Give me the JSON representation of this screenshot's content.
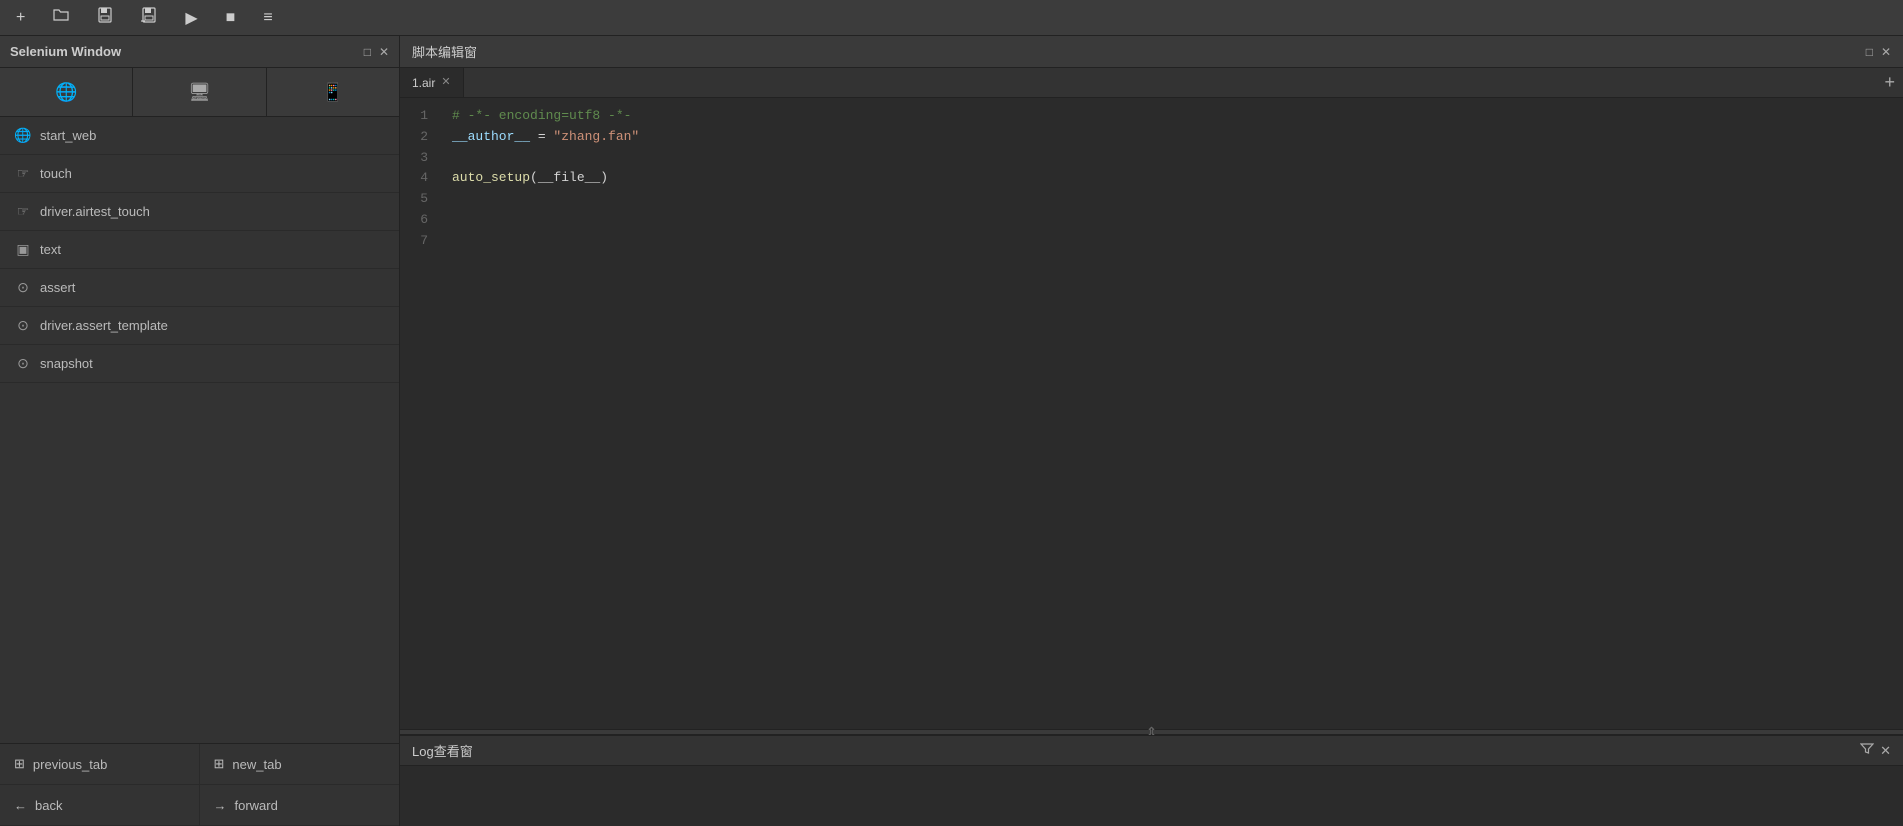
{
  "toolbar": {
    "buttons": [
      {
        "name": "new-file",
        "icon": "+",
        "label": "New"
      },
      {
        "name": "open-file",
        "icon": "📁",
        "label": "Open"
      },
      {
        "name": "save-file",
        "icon": "💾",
        "label": "Save"
      },
      {
        "name": "save-all",
        "icon": "💾",
        "label": "SaveAll"
      },
      {
        "name": "run",
        "icon": "▶",
        "label": "Run"
      },
      {
        "name": "stop",
        "icon": "■",
        "label": "Stop"
      },
      {
        "name": "menu",
        "icon": "≡",
        "label": "Menu"
      }
    ]
  },
  "sidebar": {
    "title": "Selenium Window",
    "icon_tabs": [
      {
        "name": "globe-icon",
        "icon": "🌐"
      },
      {
        "name": "monitor-icon",
        "icon": "🖥"
      },
      {
        "name": "device-icon",
        "icon": "📱"
      }
    ],
    "items": [
      {
        "name": "start-web",
        "icon": "🌐",
        "label": "start_web"
      },
      {
        "name": "touch",
        "icon": "☞",
        "label": "touch"
      },
      {
        "name": "driver-airtest-touch",
        "icon": "☞",
        "label": "driver.airtest_touch"
      },
      {
        "name": "text",
        "icon": "▣",
        "label": "text"
      },
      {
        "name": "assert",
        "icon": "⊙",
        "label": "assert"
      },
      {
        "name": "driver-assert-template",
        "icon": "⊙",
        "label": "driver.assert_template"
      },
      {
        "name": "snapshot",
        "icon": "⊙",
        "label": "snapshot"
      }
    ],
    "bottom_items": [
      {
        "name": "previous-tab",
        "icon": "⊞",
        "label": "previous_tab"
      },
      {
        "name": "new-tab",
        "icon": "⊞",
        "label": "new_tab"
      },
      {
        "name": "back",
        "icon": "←",
        "label": "back"
      },
      {
        "name": "forward",
        "icon": "→",
        "label": "forward"
      }
    ]
  },
  "editor": {
    "header_title": "脚本编辑窗",
    "tab_name": "1.air",
    "new_tab_icon": "+",
    "lines": [
      {
        "num": "1",
        "content": "# -*- encoding=utf8 -*-",
        "type": "comment"
      },
      {
        "num": "2",
        "content": "__author__ = \"zhang.fan\"",
        "type": "mixed"
      },
      {
        "num": "3",
        "content": "",
        "type": "plain"
      },
      {
        "num": "4",
        "content": "auto_setup(__file__)",
        "type": "func"
      },
      {
        "num": "5",
        "content": "",
        "type": "plain"
      },
      {
        "num": "6",
        "content": "",
        "type": "plain"
      },
      {
        "num": "7",
        "content": "",
        "type": "plain"
      }
    ]
  },
  "log_panel": {
    "title": "Log查看窗",
    "filter_icon": "▼",
    "close_icon": "×"
  },
  "colors": {
    "bg_dark": "#2b2b2b",
    "bg_medium": "#333333",
    "bg_light": "#3a3a3a",
    "accent": "#569cd6",
    "text_main": "#cccccc",
    "text_dim": "#888888",
    "comment": "#608b4e",
    "string": "#ce9178",
    "keyword": "#9cdcfe",
    "func": "#dcdcaa"
  }
}
